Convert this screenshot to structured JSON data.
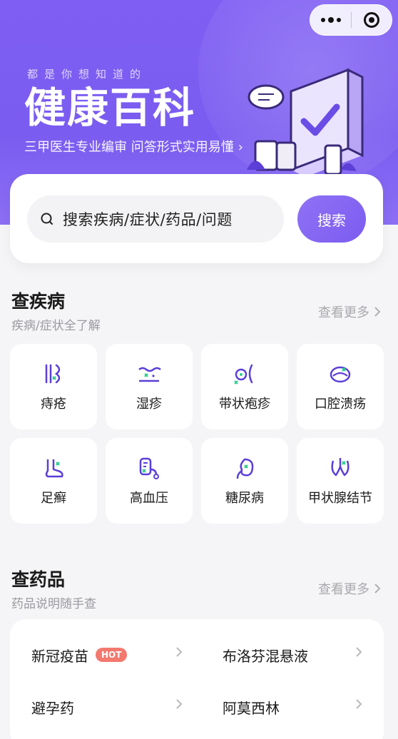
{
  "hero": {
    "tagline": "都是你想知道的",
    "title": "健康百科",
    "subtitle": "三甲医生专业编审  问答形式实用易懂",
    "subtitle_arrow": "›"
  },
  "search": {
    "placeholder": "搜索疾病/症状/药品/问题",
    "button": "搜索"
  },
  "diseases": {
    "title": "查疾病",
    "subtitle": "疾病/症状全了解",
    "more": "查看更多",
    "items": [
      {
        "label": "痔疮",
        "icon": "hemorrhoid-icon"
      },
      {
        "label": "湿疹",
        "icon": "eczema-icon"
      },
      {
        "label": "带状疱疹",
        "icon": "shingles-icon"
      },
      {
        "label": "口腔溃疡",
        "icon": "mouth-ulcer-icon"
      },
      {
        "label": "足癣",
        "icon": "foot-icon"
      },
      {
        "label": "高血压",
        "icon": "blood-pressure-icon"
      },
      {
        "label": "糖尿病",
        "icon": "kidney-icon"
      },
      {
        "label": "甲状腺结节",
        "icon": "thyroid-icon"
      }
    ]
  },
  "drugs": {
    "title": "查药品",
    "subtitle": "药品说明随手查",
    "more": "查看更多",
    "hot_badge": "HOT",
    "items": [
      {
        "name": "新冠疫苗"
      },
      {
        "name": "布洛芬混悬液"
      },
      {
        "name": "避孕药"
      },
      {
        "name": "阿莫西林"
      }
    ]
  },
  "colors": {
    "brand": "#7b5cf0",
    "accent_green": "#2ecc8f",
    "hot": "#f3796e"
  }
}
